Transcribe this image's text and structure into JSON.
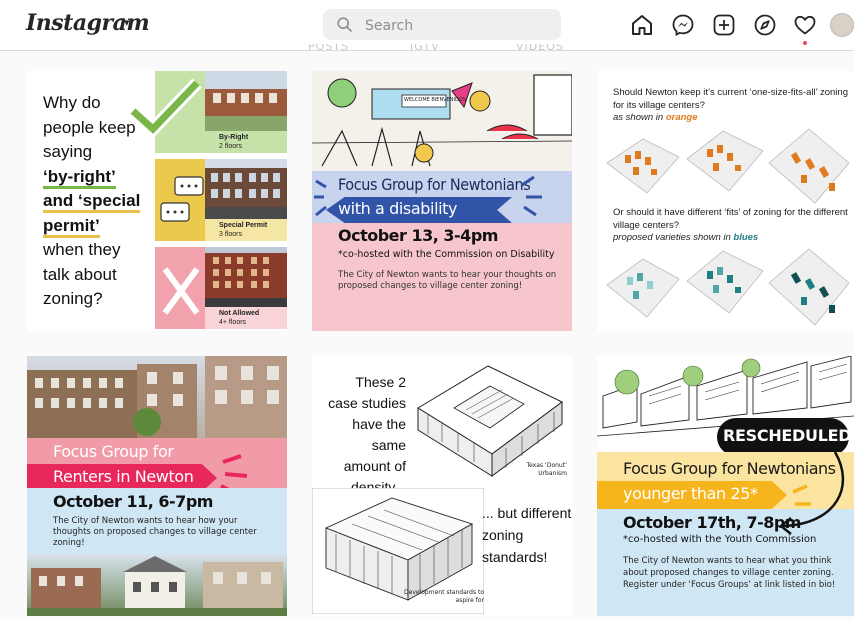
{
  "header": {
    "logo": "Instagram",
    "search_placeholder": "Search",
    "icons": [
      "home-icon",
      "messenger-icon",
      "new-post-icon",
      "explore-icon",
      "activity-heart-icon",
      "profile-avatar"
    ]
  },
  "profile_tabs": [
    "POSTS",
    "IGTV",
    "VIDEOS"
  ],
  "posts": [
    {
      "question": [
        "Why do",
        "people keep",
        "saying",
        "‘by-right’",
        "and ‘special",
        "permit’",
        "when they",
        "talk about",
        "zoning?"
      ],
      "rows": [
        {
          "title": "By-Right",
          "sub": "2 floors"
        },
        {
          "title": "Special Permit",
          "sub": "3 floors"
        },
        {
          "title": "Not Allowed",
          "sub": "4+ floors"
        }
      ]
    },
    {
      "title1": "Focus Group for Newtonians",
      "title2": "with a disability",
      "date": "October 13, 3-4pm",
      "cohost": "*co-hosted with the Commission on Disability",
      "body": "The City of Newton wants to hear your thoughts on proposed changes to village center zoning!",
      "sign": "WELCOME BIENVENIDOS"
    },
    {
      "q1": "Should Newton keep it’s current ‘one-size-fits-all’ zoning for its village centers?",
      "q1_note": "as shown in ",
      "q1_color": "orange",
      "q2": "Or should it have different ‘fits’ of zoning for the different village centers?",
      "q2_note": "proposed varieties shown in ",
      "q2_color": "blues"
    },
    {
      "title1": "Focus Group for",
      "title2": "Renters in Newton",
      "date": "October 11, 6-7pm",
      "body": "The City of Newton wants to hear how your thoughts on proposed changes to village center zoning!"
    },
    {
      "textA": "These 2 case studies have the same amount of density...",
      "textB": "... but different zoning standards!",
      "cap1": "Texas ‘Donut’ Urbanism",
      "cap2": "Development standards to aspire for"
    },
    {
      "badge": "RESCHEDULED!",
      "title1": "Focus Group for Newtonians",
      "title2": "younger than 25*",
      "date": "October 17th, 7-8pm",
      "cohost": "*co-hosted with the Youth Commission",
      "body": "The City of Newton wants to hear what you think about proposed changes to village center zoning. Register under ‘Focus Groups’ at link listed in bio!"
    }
  ],
  "colors": {
    "accent_green": "#7ab648",
    "accent_yellow": "#e6c24a",
    "accent_pink": "#f29ba8",
    "disability_blue": "#3254a8",
    "renters_red": "#e8285a",
    "youth_yellow": "#f7b51d",
    "zoning_orange": "#e07a1f",
    "zoning_teal": "#1f7f84"
  }
}
